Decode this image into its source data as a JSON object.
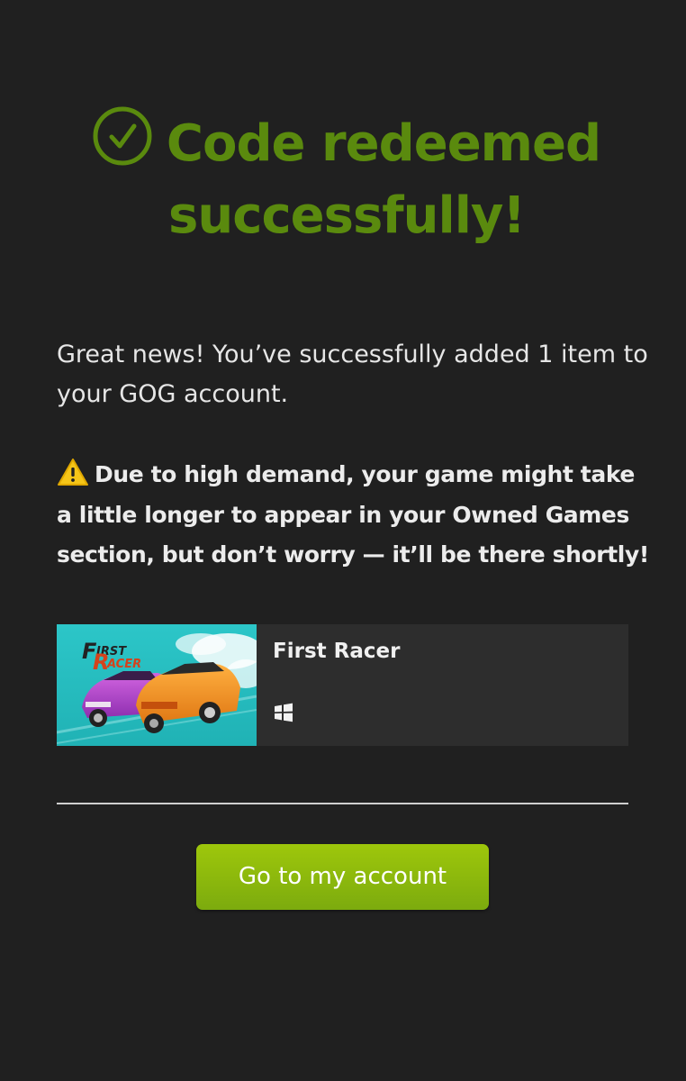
{
  "heading": {
    "line1": "Code redeemed",
    "line2": "successfully!",
    "icon": "check-circle-icon",
    "color": "#5a8a0e"
  },
  "message": "Great news! You’ve successfully added 1 item to your GOG account.",
  "notice": {
    "icon": "warning-icon",
    "text": "Due to high demand, your game might take a little longer to appear in your Owned Games section, but don’t worry — it’ll be there shortly!"
  },
  "product": {
    "title": "First Racer",
    "platform_icon": "windows-icon",
    "cover_logo": {
      "line1": "IRST",
      "line2": "ACER"
    }
  },
  "button": {
    "label": "Go to my account",
    "color": "#8dbb0c"
  }
}
